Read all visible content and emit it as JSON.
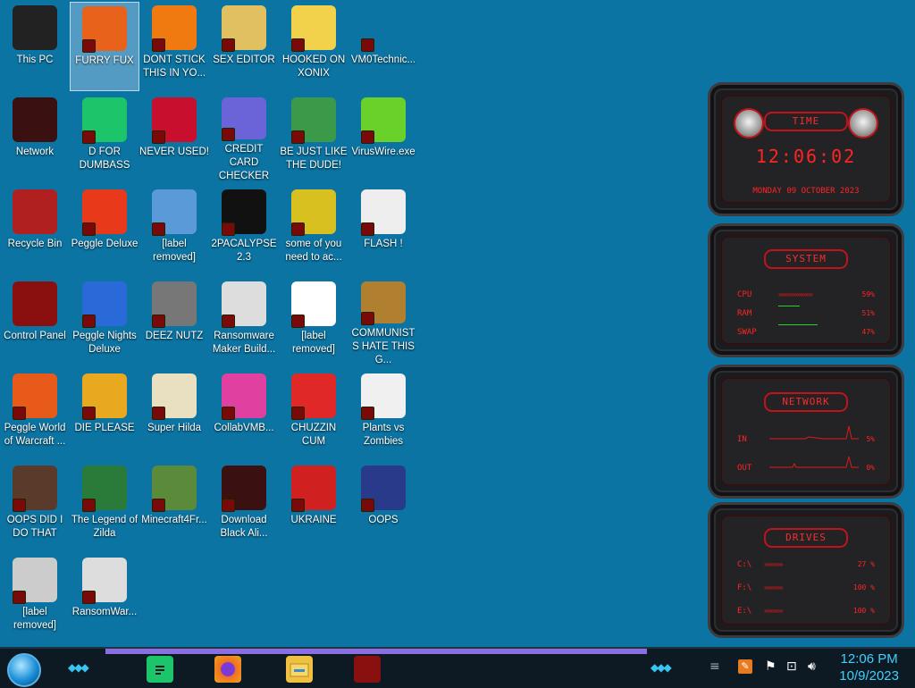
{
  "desktop": {
    "icons": [
      {
        "label": "This PC",
        "icon": "monitor-icon",
        "color": "#222"
      },
      {
        "label": "FURRY FUX",
        "icon": "firefox-icon",
        "color": "#e8621b",
        "selected": true
      },
      {
        "label": "DONT STICK THIS IN YO...",
        "icon": "traffic-cone-icon",
        "color": "#f07a10"
      },
      {
        "label": "SEX EDITOR",
        "icon": "hxd-editor-icon",
        "color": "#e0c060"
      },
      {
        "label": "HOOKED ON XONIX",
        "icon": "cartoon-girl-icon",
        "color": "#f2d24a"
      },
      {
        "label": "VM0Technic...",
        "icon": "blank-icon",
        "color": "#0b74a3"
      },
      {
        "label": "Network",
        "icon": "alien-network-icon",
        "color": "#3a1010"
      },
      {
        "label": "D FOR DUMBASS",
        "icon": "chat-bubble-icon",
        "color": "#1cc46a"
      },
      {
        "label": "NEVER USED!",
        "icon": "devcpp-icon",
        "color": "#c8102e"
      },
      {
        "label": "CREDIT CARD CHECKER",
        "icon": "credit-card-icon",
        "color": "#6a64d8"
      },
      {
        "label": "BE JUST LIKE THE DUDE!",
        "icon": "gnome-icon",
        "color": "#3a9a4a"
      },
      {
        "label": "VirusWire.exe",
        "icon": "lime-icon",
        "color": "#6ad02a"
      },
      {
        "label": "Recycle Bin",
        "icon": "trash-can-icon",
        "color": "#b02020"
      },
      {
        "label": "Peggle Deluxe",
        "icon": "peggle-icon",
        "color": "#e83a1a"
      },
      {
        "label": "[label removed]",
        "icon": "network-share-icon",
        "color": "#5a9ad8"
      },
      {
        "label": "2PACALYPSE 2.3",
        "icon": "terminal-icon",
        "color": "#111"
      },
      {
        "label": "some of you need to ac...",
        "icon": "cartoon-dog-icon",
        "color": "#d8c020"
      },
      {
        "label": "FLASH !",
        "icon": "document-icon",
        "color": "#eee"
      },
      {
        "label": "Control Panel",
        "icon": "control-panel-icon",
        "color": "#8a1010"
      },
      {
        "label": "Peggle Nights Deluxe",
        "icon": "peggle-nights-icon",
        "color": "#2a6ad8"
      },
      {
        "label": "DEEZ NUTZ",
        "icon": "stacked-windows-icon",
        "color": "#777"
      },
      {
        "label": "Ransomware Maker Build...",
        "icon": "installer-window-icon",
        "color": "#ddd"
      },
      {
        "label": "[label removed]",
        "icon": "flags-icon",
        "color": "#fff"
      },
      {
        "label": "COMMUNISTS HATE THIS G...",
        "icon": "money-bag-icon",
        "color": "#b08030"
      },
      {
        "label": "Peggle World of Warcraft ...",
        "icon": "peggle-wow-icon",
        "color": "#e85a1a"
      },
      {
        "label": "DIE PLEASE",
        "icon": "de-letter-icon",
        "color": "#e8a820"
      },
      {
        "label": "Super Hilda",
        "icon": "pixel-cat-icon",
        "color": "#e8e0c0"
      },
      {
        "label": "CollabVMB...",
        "icon": "pink-screen-icon",
        "color": "#e040a0"
      },
      {
        "label": "CHUZZIN CUM",
        "icon": "chuzzle-icon",
        "color": "#e02828"
      },
      {
        "label": "Plants vs Zombies",
        "icon": "flower-icon",
        "color": "#f0f0f0"
      },
      {
        "label": "OOPS DID I DO THAT",
        "icon": "portrait-icon",
        "color": "#5a3a2a"
      },
      {
        "label": "The Legend of Zilda",
        "icon": "pixel-hero-icon",
        "color": "#2a7a3a"
      },
      {
        "label": "Minecraft4Fr...",
        "icon": "grass-block-icon",
        "color": "#5a8a3a"
      },
      {
        "label": "Download Black Ali...",
        "icon": "alien-download-icon",
        "color": "#3a1010"
      },
      {
        "label": "UKRAINE",
        "icon": "radiation-icon",
        "color": "#d02020"
      },
      {
        "label": "OOPS",
        "icon": "book-icon",
        "color": "#2a3a8a"
      },
      {
        "label": "[label removed]",
        "icon": "noose-icon",
        "color": "#ccc"
      },
      {
        "label": "RansomWar...",
        "icon": "skull-icon",
        "color": "#ddd"
      }
    ]
  },
  "widget": {
    "time_title": "TIME",
    "time_value": "12:06:02",
    "date_value": "MONDAY 09 OCTOBER 2023",
    "system_title": "SYSTEM",
    "cpu_label": "CPU",
    "cpu_value": "59%",
    "cpu_level": 0.59,
    "ram_label": "RAM",
    "ram_value": "51%",
    "swap_label": "SWAP",
    "swap_value": "47%",
    "network_title": "NETWORK",
    "in_label": "IN",
    "in_value": "5%",
    "out_label": "OUT",
    "out_value": "0%",
    "drives_title": "DRIVES",
    "drives": [
      {
        "label": "C:\\",
        "value": "27 %"
      },
      {
        "label": "F:\\",
        "value": "100 %"
      },
      {
        "label": "E:\\",
        "value": "100 %"
      }
    ]
  },
  "taskbar": {
    "start_icon": "start-orb-icon",
    "apps": [
      "chat-app-icon",
      "firefox-icon",
      "file-explorer-icon",
      "control-panel-icon"
    ],
    "tray": [
      "sketch-app-icon",
      "flag-icon",
      "network-icon",
      "volume-icon"
    ],
    "time": "12:06 PM",
    "date": "10/9/2023"
  }
}
